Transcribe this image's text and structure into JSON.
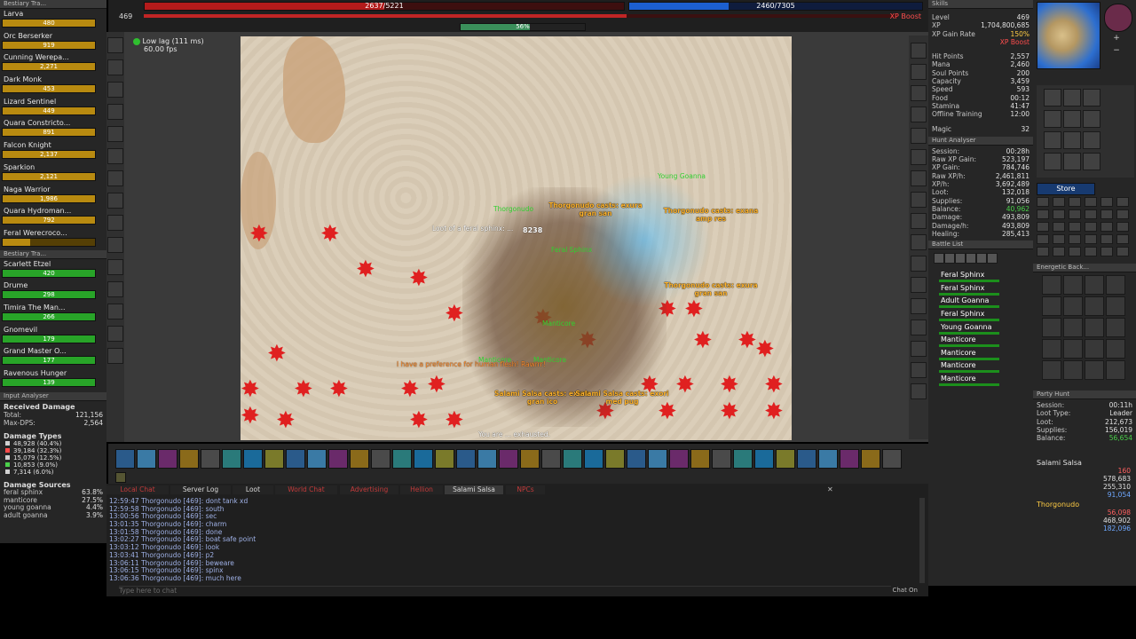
{
  "top": {
    "health_current": "2637/5221",
    "mana_current": "2460/7305",
    "level_left": "469",
    "xp_boost_label": "XP Boost",
    "xp_percent": "56%",
    "xp_fill": 0.56
  },
  "status": {
    "lag_label": "Low lag (111 ms)",
    "fps_label": "60.00 fps"
  },
  "bestiary": {
    "title": "Bestiary Tra...",
    "items": [
      {
        "name": "Larva",
        "value": "480",
        "fill": 1.0,
        "color": "#b88a10"
      },
      {
        "name": "Orc Berserker",
        "value": "919",
        "fill": 1.0,
        "color": "#b88a10"
      },
      {
        "name": "Cunning Werepa...",
        "value": "2,271",
        "fill": 1.0,
        "color": "#b88a10"
      },
      {
        "name": "Dark Monk",
        "value": "453",
        "fill": 1.0,
        "color": "#b88a10"
      },
      {
        "name": "Lizard Sentinel",
        "value": "449",
        "fill": 1.0,
        "color": "#b88a10"
      },
      {
        "name": "Quara Constricto...",
        "value": "891",
        "fill": 1.0,
        "color": "#b88a10"
      },
      {
        "name": "Falcon Knight",
        "value": "2,137",
        "fill": 1.0,
        "color": "#b88a10"
      },
      {
        "name": "Sparkion",
        "value": "2,121",
        "fill": 1.0,
        "color": "#b88a10"
      },
      {
        "name": "Naga Warrior",
        "value": "1,986",
        "fill": 1.0,
        "color": "#b88a10"
      },
      {
        "name": "Quara Hydroman...",
        "value": "792",
        "fill": 1.0,
        "color": "#b88a10"
      },
      {
        "name": "Feral Werecroco...",
        "value": "",
        "fill": 0.3,
        "color": "#b88a10"
      }
    ]
  },
  "bestiary2": {
    "title": "Bestiary Tra...",
    "items": [
      {
        "name": "Scarlett Etzel",
        "value": "420",
        "fill": 1.0,
        "color": "#28a428"
      },
      {
        "name": "Drume",
        "value": "298",
        "fill": 1.0,
        "color": "#28a428"
      },
      {
        "name": "Timira The Man...",
        "value": "266",
        "fill": 1.0,
        "color": "#28a428"
      },
      {
        "name": "Gnomevil",
        "value": "179",
        "fill": 1.0,
        "color": "#28a428"
      },
      {
        "name": "Grand Master O...",
        "value": "177",
        "fill": 1.0,
        "color": "#28a428"
      },
      {
        "name": "Ravenous Hunger",
        "value": "139",
        "fill": 1.0,
        "color": "#28a428"
      }
    ]
  },
  "input_analyser": {
    "title": "Input Analyser",
    "received_damage": "Received Damage",
    "total_label": "Total:",
    "total_value": "121,156",
    "maxdps_label": "Max-DPS:",
    "maxdps_value": "2,564",
    "damage_types_label": "Damage Types",
    "types": [
      {
        "value": "48,928 (40.4%)",
        "color": "#d0d0d0"
      },
      {
        "value": "39,184 (32.3%)",
        "color": "#ff4a4a"
      },
      {
        "value": "15,079 (12.5%)",
        "color": "#d0d0d0"
      },
      {
        "value": "10,853 (9.0%)",
        "color": "#4ad04a"
      },
      {
        "value": "7,314 (6.0%)",
        "color": "#d0d0d0"
      }
    ],
    "damage_sources_label": "Damage Sources",
    "sources": [
      {
        "name": "feral sphinx",
        "value": "63.8%"
      },
      {
        "name": "manticore",
        "value": "27.5%"
      },
      {
        "name": "young goanna",
        "value": "4.4%"
      },
      {
        "name": "adult goanna",
        "value": "3.9%"
      }
    ]
  },
  "chat": {
    "tabs": [
      "Local Chat",
      "Server Log",
      "Loot",
      "World Chat",
      "Advertising",
      "Hellion",
      "Salami Salsa",
      "NPCs"
    ],
    "lines": [
      "12:59:47 Thorgonudo [469]: dont tank xd",
      "12:59:58 Thorgonudo [469]: south",
      "13:00:56 Thorgonudo [469]: sec",
      "13:01:35 Thorgonudo [469]: charm",
      "13:01:58 Thorgonudo [469]: done",
      "13:02:27 Thorgonudo [469]: boat safe point",
      "13:03:12 Thorgonudo [469]: look",
      "13:03:41 Thorgonudo [469]: p2",
      "13:06:11 Thorgonudo [469]: beweare",
      "13:06:15 Thorgonudo [469]: spinx",
      "13:06:36 Thorgonudo [469]: much here"
    ],
    "input_placeholder": "Type here to chat",
    "chat_on_label": "Chat On"
  },
  "game": {
    "casts": [
      {
        "text": "Thorgonudo casts: exura gran san",
        "color": "#ffb32b"
      },
      {
        "text": "Thorgonudo casts: exana amp res",
        "color": "#ffb32b"
      },
      {
        "text": "Thorgonudo casts: exura gran san",
        "color": "#ffb32b"
      },
      {
        "text": "Salami Salsa casts: exura gran ico",
        "color": "#ffb32b"
      },
      {
        "text": "Salami Salsa casts: exori med pug",
        "color": "#ffb32b"
      }
    ],
    "names": [
      "Young Goanna",
      "Thorgonudo",
      "Feral Sphinx",
      "Manticore",
      "Manticore",
      "Manticore"
    ],
    "loot_text": "Loot of a feral sphinx: ...",
    "warning": "I have a preference for human flesh! Rawrrr!",
    "bottom_text": "You are ... exhausted.",
    "damage": "8238"
  },
  "skills": {
    "title": "Skills",
    "rows": [
      {
        "label": "Level",
        "value": "469"
      },
      {
        "label": "XP",
        "value": "1,704,800,685"
      },
      {
        "label": "XP Gain Rate",
        "value": "150%"
      },
      {
        "label": "",
        "value": "XP Boost"
      },
      {
        "label": "Hit Points",
        "value": "2,557"
      },
      {
        "label": "Mana",
        "value": "2,460"
      },
      {
        "label": "Soul Points",
        "value": "200"
      },
      {
        "label": "Capacity",
        "value": "3,459"
      },
      {
        "label": "Speed",
        "value": "593"
      },
      {
        "label": "Food",
        "value": "00:12"
      },
      {
        "label": "Stamina",
        "value": "41:47"
      },
      {
        "label": "Offline Training",
        "value": "12:00"
      },
      {
        "label": "Magic",
        "value": "32"
      }
    ]
  },
  "hunt_analyser": {
    "title": "Hunt Analyser",
    "rows": [
      {
        "label": "Session:",
        "value": "00:28h"
      },
      {
        "label": "Raw XP Gain:",
        "value": "523,197"
      },
      {
        "label": "XP Gain:",
        "value": "784,746"
      },
      {
        "label": "Raw XP/h:",
        "value": "2,461,811"
      },
      {
        "label": "XP/h:",
        "value": "3,692,489"
      },
      {
        "label": "Loot:",
        "value": "132,018"
      },
      {
        "label": "Supplies:",
        "value": "91,056"
      },
      {
        "label": "Balance:",
        "value": "40,962"
      },
      {
        "label": "Damage:",
        "value": "493,809"
      },
      {
        "label": "Damage/h:",
        "value": "493,809"
      },
      {
        "label": "Healing:",
        "value": "285,413"
      }
    ]
  },
  "battle_list": {
    "title": "Battle List",
    "entries": [
      "Feral Sphinx",
      "Feral Sphinx",
      "Adult Goanna",
      "Feral Sphinx",
      "Young Goanna",
      "Manticore",
      "Manticore",
      "Manticore",
      "Manticore"
    ]
  },
  "store": {
    "label": "Store"
  },
  "energetic_backpack": {
    "title": "Energetic Back..."
  },
  "party_hunt": {
    "title": "Party Hunt",
    "rows": [
      {
        "label": "Session:",
        "value": "00:11h"
      },
      {
        "label": "Loot Type:",
        "value": "Leader"
      },
      {
        "label": "Loot:",
        "value": "212,673"
      },
      {
        "label": "Supplies:",
        "value": "156,019"
      },
      {
        "label": "Balance:",
        "value": "56,654"
      }
    ],
    "members": [
      {
        "name": "Salami Salsa",
        "values": [
          "160",
          "578,683",
          "255,310",
          "91,054"
        ]
      },
      {
        "name": "Thorgonudo",
        "values": [
          "56,098",
          "468,902",
          "182,096"
        ]
      }
    ]
  },
  "colors": {
    "health": "#b31b1b",
    "mana": "#1c5fd0",
    "gold_bar": "#b88a10",
    "green_bar": "#28a428",
    "panel": "#2b2b2b"
  }
}
